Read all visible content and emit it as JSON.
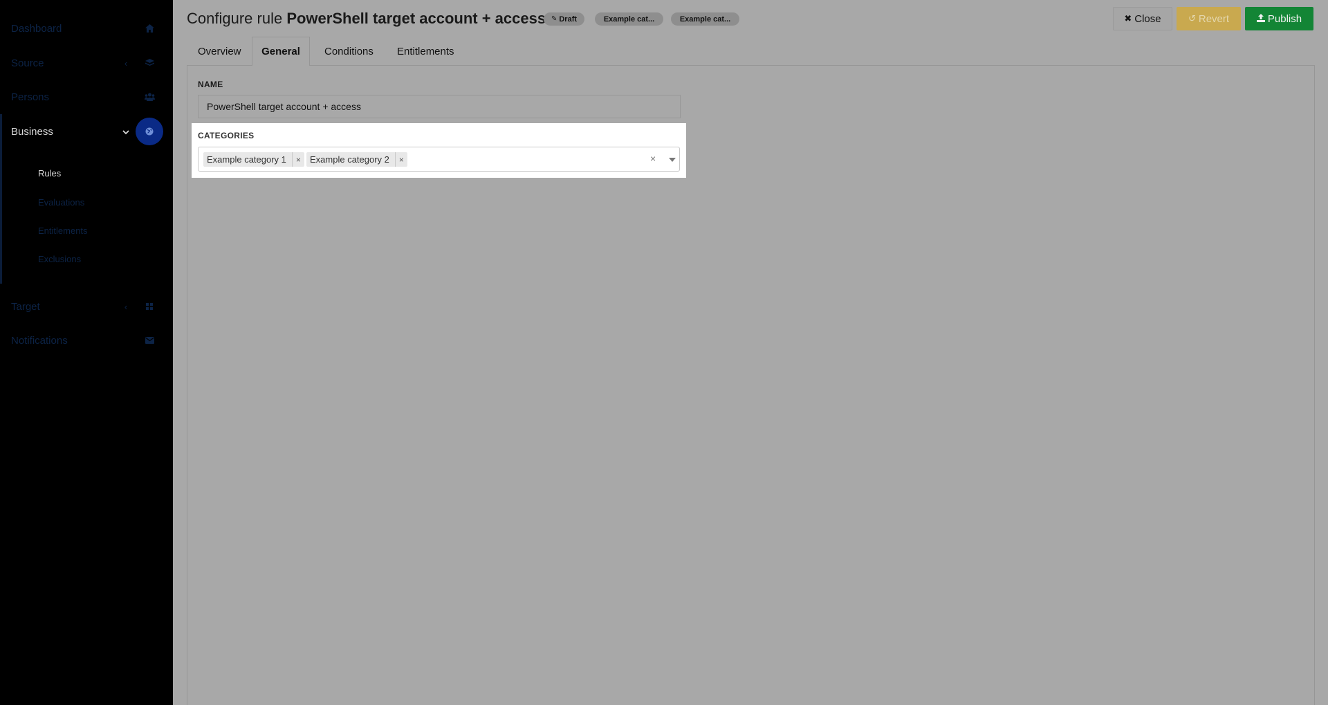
{
  "sidebar": {
    "items": [
      {
        "label": "Dashboard",
        "icon": "home-icon"
      },
      {
        "label": "Source",
        "icon": "layers-icon"
      },
      {
        "label": "Persons",
        "icon": "users-icon"
      },
      {
        "label": "Business",
        "icon": "globe-icon"
      },
      {
        "label": "Target",
        "icon": "grid-icon"
      },
      {
        "label": "Notifications",
        "icon": "envelope-icon"
      }
    ],
    "business_sub": [
      {
        "label": "Rules"
      },
      {
        "label": "Evaluations"
      },
      {
        "label": "Entitlements"
      },
      {
        "label": "Exclusions"
      }
    ]
  },
  "header": {
    "title_prefix": "Configure rule",
    "title_name": "PowerShell target account + access",
    "badges": {
      "draft": "Draft",
      "cat1": "Example cat...",
      "cat2": "Example cat..."
    },
    "buttons": {
      "close": "Close",
      "revert": "Revert",
      "publish": "Publish"
    }
  },
  "tabs": [
    "Overview",
    "General",
    "Conditions",
    "Entitlements"
  ],
  "form": {
    "name_label": "NAME",
    "name_value": "PowerShell target account + access",
    "categories_label": "CATEGORIES",
    "categories": [
      "Example category 1",
      "Example category 2"
    ]
  },
  "colors": {
    "publish": "#138535",
    "revert": "#c9a94f",
    "business_active": "#0a2a86"
  }
}
